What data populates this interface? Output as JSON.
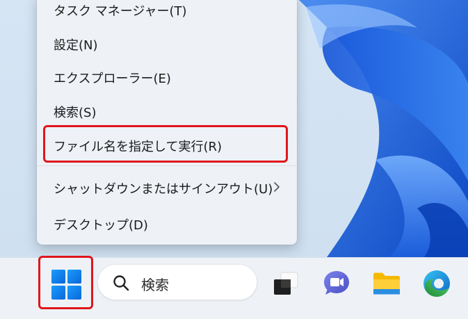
{
  "context_menu": {
    "items": [
      {
        "label": "タスク マネージャー(T)"
      },
      {
        "label": "設定(N)"
      },
      {
        "label": "エクスプローラー(E)"
      },
      {
        "label": "検索(S)"
      },
      {
        "label": "ファイル名を指定して実行(R)"
      },
      {
        "label": "シャットダウンまたはサインアウト(U)",
        "submenu_icon": "chevron-right-icon"
      },
      {
        "label": "デスクトップ(D)"
      }
    ],
    "highlighted_item": "ファイル名を指定して実行(R)"
  },
  "taskbar": {
    "start_icon": "windows-logo-icon",
    "search": {
      "icon": "search-icon",
      "label": "検索"
    },
    "apps": [
      {
        "icon": "task-view-icon"
      },
      {
        "icon": "teams-chat-icon"
      },
      {
        "icon": "file-explorer-icon"
      },
      {
        "icon": "edge-browser-icon"
      }
    ]
  },
  "colors": {
    "highlight_border": "#e0161b",
    "menu_background": "#eef1f6",
    "taskbar_background": "#eef2f7",
    "windows_blue": "#0a6fd8"
  }
}
